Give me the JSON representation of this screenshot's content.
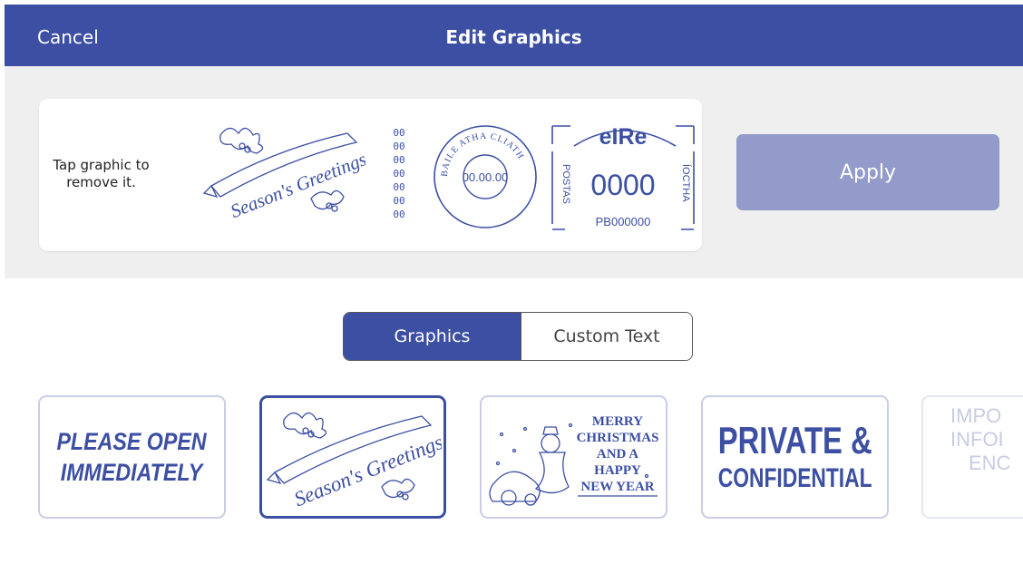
{
  "header": {
    "cancel_label": "Cancel",
    "title": "Edit Graphics"
  },
  "preview": {
    "hint": "Tap graphic to remove it.",
    "graphic": {
      "text": "Season's Greetings"
    },
    "counter_digits": [
      "00",
      "00",
      "00",
      "00",
      "00",
      "00",
      "00"
    ],
    "postmark": {
      "ring_text": "BAILE ATHA CLIATH",
      "date": "00.00.00"
    },
    "meter": {
      "country": "eIRe",
      "left_side": "POSTAS",
      "right_side": "ÍOCTHA",
      "amount": "0000",
      "serial": "PB000000"
    }
  },
  "apply_label": "Apply",
  "tabs": {
    "graphics": "Graphics",
    "custom_text": "Custom Text"
  },
  "tiles": {
    "please_open": [
      "PLEASE OPEN",
      "IMMEDIATELY"
    ],
    "seasons_greetings": "Season's Greetings",
    "merry_christmas": [
      "MERRY",
      "CHRISTMAS",
      "AND A",
      "HAPPY",
      "NEW YEAR"
    ],
    "private": [
      "PRIVATE &",
      "CONFIDENTIAL"
    ],
    "important_partial": [
      "IMPO",
      "INFOI",
      "ENC"
    ]
  },
  "colors": {
    "brand": "#3c4fa3",
    "apply_disabled": "#929bca",
    "panel": "#efeff0",
    "tile_border": "#c9cde6"
  }
}
